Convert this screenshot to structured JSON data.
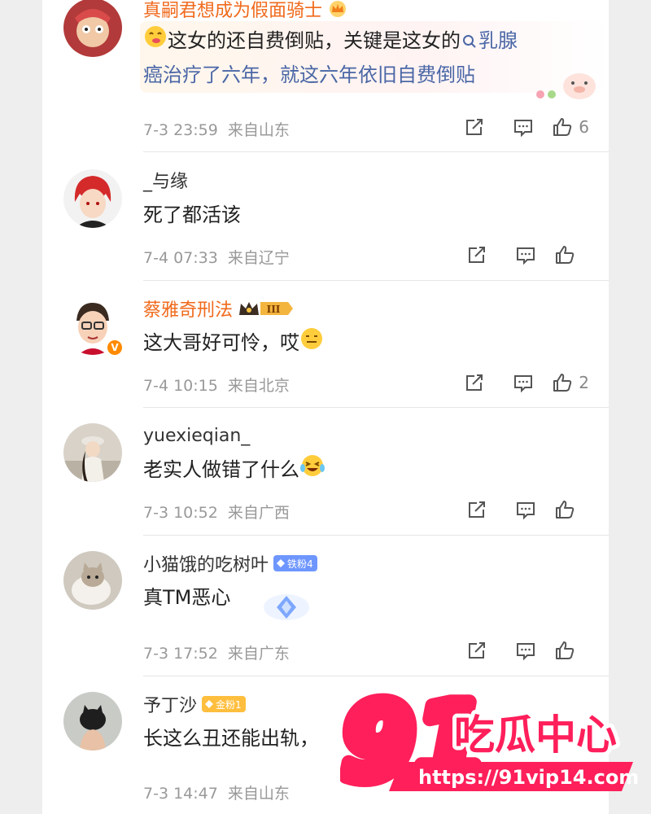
{
  "comments": [
    {
      "name": "真嗣君想成为假面骑士",
      "text_a": "这女的还自费倒贴，关键是这女的",
      "link": "乳腺",
      "text_b": "癌治疗了六年，就这六年依旧自费倒贴",
      "date": "7-3 23:59",
      "location": "来自山东",
      "likes": "6"
    },
    {
      "name": "_与缘",
      "text": "死了都活该",
      "date": "7-4 07:33",
      "location": "来自辽宁",
      "likes": ""
    },
    {
      "name": "蔡雅奇刑法",
      "crown_level": "III",
      "text": "这大哥好可怜，哎",
      "date": "7-4 10:15",
      "location": "来自北京",
      "likes": "2"
    },
    {
      "name": "yuexieqian_",
      "text": "老实人做错了什么",
      "date": "7-3 10:52",
      "location": "来自广西",
      "likes": ""
    },
    {
      "name": "小猫饿的吃树叶",
      "badge": "铁粉4",
      "text": "真TM恶心",
      "date": "7-3 17:52",
      "location": "来自广东",
      "likes": ""
    },
    {
      "name": "予丁沙",
      "badge": "金粉1",
      "text": "长这么丑还能出轨，",
      "date": "7-3 14:47",
      "location": "来自山东",
      "likes": ""
    }
  ],
  "watermark": {
    "number": "91",
    "title": "吃瓜中心",
    "url": "https://91vip14.com"
  },
  "colors": {
    "name_vip": "#f06a1c",
    "link": "#4a67a6",
    "meta": "#999999",
    "watermark": "#ff1f5a"
  },
  "icons": [
    "share-icon",
    "reply-icon",
    "thumbs-up-icon",
    "search-icon",
    "crown-icon",
    "diamond-icon",
    "v-badge-icon"
  ]
}
